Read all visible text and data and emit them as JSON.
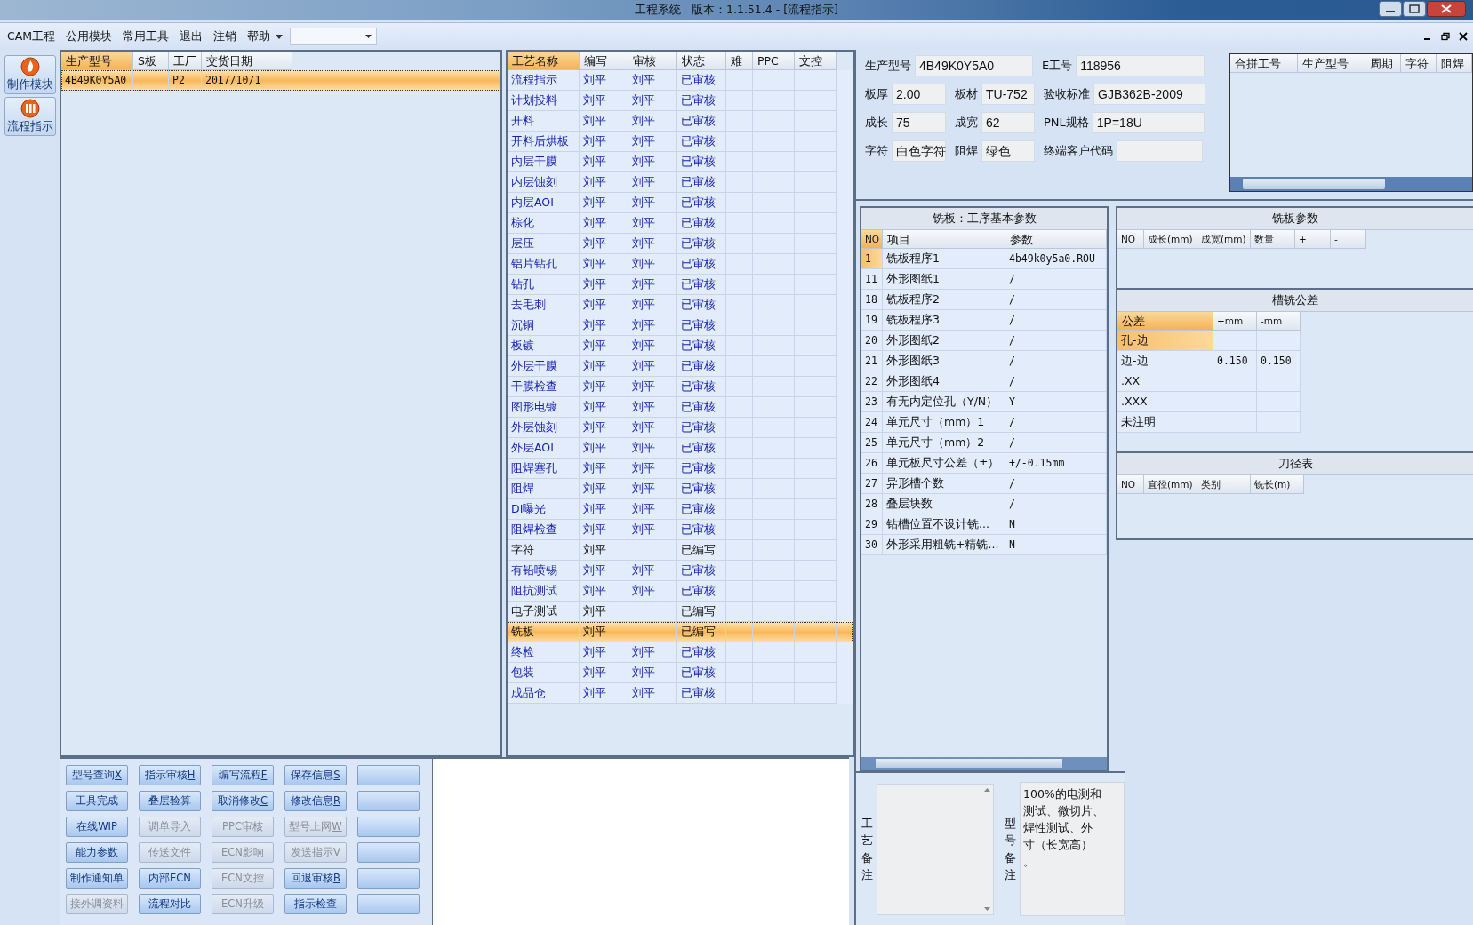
{
  "window": {
    "title": "工程系统   版本：1.1.51.4 - [流程指示]"
  },
  "menu": [
    "CAM工程",
    "公用模块",
    "常用工具",
    "退出",
    "注销",
    "帮助"
  ],
  "side_buttons": [
    {
      "label": "制作模块",
      "kind": "make"
    },
    {
      "label": "流程指示",
      "kind": "flow"
    }
  ],
  "model_table": {
    "columns": [
      {
        "label": "生产型号",
        "selected": true
      },
      {
        "label": "S板",
        "selected": false
      },
      {
        "label": "工厂",
        "selected": false
      },
      {
        "label": "交货日期",
        "selected": false
      }
    ],
    "rows": [
      {
        "cells": [
          "4B49K0Y5A0",
          "",
          "P2",
          "2017/10/1"
        ],
        "selected": true
      }
    ]
  },
  "process_table": {
    "columns": [
      {
        "label": "工艺名称",
        "selected": true
      },
      {
        "label": "编写",
        "selected": false
      },
      {
        "label": "审核",
        "selected": false
      },
      {
        "label": "状态",
        "selected": false
      },
      {
        "label": "难",
        "selected": false
      },
      {
        "label": "PPC",
        "selected": false
      },
      {
        "label": "文控",
        "selected": false
      }
    ],
    "rows": [
      {
        "name": "流程指示",
        "writer": "刘平",
        "reviewer": "刘平",
        "status": "已审核",
        "approved": true,
        "selected": false
      },
      {
        "name": "计划投料",
        "writer": "刘平",
        "reviewer": "刘平",
        "status": "已审核",
        "approved": true,
        "selected": false
      },
      {
        "name": "开料",
        "writer": "刘平",
        "reviewer": "刘平",
        "status": "已审核",
        "approved": true,
        "selected": false
      },
      {
        "name": "开料后烘板",
        "writer": "刘平",
        "reviewer": "刘平",
        "status": "已审核",
        "approved": true,
        "selected": false
      },
      {
        "name": "内层干膜",
        "writer": "刘平",
        "reviewer": "刘平",
        "status": "已审核",
        "approved": true,
        "selected": false
      },
      {
        "name": "内层蚀刻",
        "writer": "刘平",
        "reviewer": "刘平",
        "status": "已审核",
        "approved": true,
        "selected": false
      },
      {
        "name": "内层AOI",
        "writer": "刘平",
        "reviewer": "刘平",
        "status": "已审核",
        "approved": true,
        "selected": false
      },
      {
        "name": "棕化",
        "writer": "刘平",
        "reviewer": "刘平",
        "status": "已审核",
        "approved": true,
        "selected": false
      },
      {
        "name": "层压",
        "writer": "刘平",
        "reviewer": "刘平",
        "status": "已审核",
        "approved": true,
        "selected": false
      },
      {
        "name": "铝片钻孔",
        "writer": "刘平",
        "reviewer": "刘平",
        "status": "已审核",
        "approved": true,
        "selected": false
      },
      {
        "name": "钻孔",
        "writer": "刘平",
        "reviewer": "刘平",
        "status": "已审核",
        "approved": true,
        "selected": false
      },
      {
        "name": "去毛刺",
        "writer": "刘平",
        "reviewer": "刘平",
        "status": "已审核",
        "approved": true,
        "selected": false
      },
      {
        "name": "沉铜",
        "writer": "刘平",
        "reviewer": "刘平",
        "status": "已审核",
        "approved": true,
        "selected": false
      },
      {
        "name": "板镀",
        "writer": "刘平",
        "reviewer": "刘平",
        "status": "已审核",
        "approved": true,
        "selected": false
      },
      {
        "name": "外层干膜",
        "writer": "刘平",
        "reviewer": "刘平",
        "status": "已审核",
        "approved": true,
        "selected": false
      },
      {
        "name": "干膜检查",
        "writer": "刘平",
        "reviewer": "刘平",
        "status": "已审核",
        "approved": true,
        "selected": false
      },
      {
        "name": "图形电镀",
        "writer": "刘平",
        "reviewer": "刘平",
        "status": "已审核",
        "approved": true,
        "selected": false
      },
      {
        "name": "外层蚀刻",
        "writer": "刘平",
        "reviewer": "刘平",
        "status": "已审核",
        "approved": true,
        "selected": false
      },
      {
        "name": "外层AOI",
        "writer": "刘平",
        "reviewer": "刘平",
        "status": "已审核",
        "approved": true,
        "selected": false
      },
      {
        "name": "阻焊塞孔",
        "writer": "刘平",
        "reviewer": "刘平",
        "status": "已审核",
        "approved": true,
        "selected": false
      },
      {
        "name": "阻焊",
        "writer": "刘平",
        "reviewer": "刘平",
        "status": "已审核",
        "approved": true,
        "selected": false
      },
      {
        "name": "DI曝光",
        "writer": "刘平",
        "reviewer": "刘平",
        "status": "已审核",
        "approved": true,
        "selected": false
      },
      {
        "name": "阻焊检查",
        "writer": "刘平",
        "reviewer": "刘平",
        "status": "已审核",
        "approved": true,
        "selected": false
      },
      {
        "name": "字符",
        "writer": "刘平",
        "status": "已编写",
        "approved": false,
        "selected": false
      },
      {
        "name": "有铅喷锡",
        "writer": "刘平",
        "reviewer": "刘平",
        "status": "已审核",
        "approved": true,
        "selected": false
      },
      {
        "name": "阻抗测试",
        "writer": "刘平",
        "reviewer": "刘平",
        "status": "已审核",
        "approved": true,
        "selected": false
      },
      {
        "name": "电子测试",
        "writer": "刘平",
        "status": "已编写",
        "approved": false,
        "selected": false
      },
      {
        "name": "铣板",
        "writer": "刘平",
        "status": "已编写",
        "approved": false,
        "selected": true
      },
      {
        "name": "终检",
        "writer": "刘平",
        "reviewer": "刘平",
        "status": "已审核",
        "approved": true,
        "selected": false
      },
      {
        "name": "包装",
        "writer": "刘平",
        "reviewer": "刘平",
        "status": "已审核",
        "approved": true,
        "selected": false
      },
      {
        "name": "成品仓",
        "writer": "刘平",
        "reviewer": "刘平",
        "status": "已审核",
        "approved": true,
        "selected": false
      }
    ]
  },
  "info": [
    [
      {
        "label": "生产型号",
        "value": "4B49K0Y5A0"
      },
      {
        "label": "E工号",
        "value": "118956"
      }
    ],
    [
      {
        "label": "板厚",
        "value": "2.00"
      },
      {
        "label": "板材",
        "value": "TU-752"
      },
      {
        "label": "验收标准",
        "value": "GJB362B-2009"
      }
    ],
    [
      {
        "label": "成长",
        "value": "75"
      },
      {
        "label": "成宽",
        "value": "62"
      },
      {
        "label": "PNL规格",
        "value": "1P=18U"
      }
    ],
    [
      {
        "label": "字符",
        "value": "白色字符"
      },
      {
        "label": "阻焊",
        "value": "绿色"
      },
      {
        "label": "终端客户代码"
      }
    ]
  ],
  "combined_table": {
    "columns": [
      "合拼工号",
      "生产型号",
      "周期",
      "字符",
      "阻焊"
    ]
  },
  "param_panel": {
    "title": "铣板：工序基本参数",
    "columns": [
      "NO",
      "项目",
      "参数"
    ],
    "rows": [
      {
        "no": "1",
        "item": "铣板程序1",
        "value": "4b49k0y5a0.ROU",
        "selected": true
      },
      {
        "no": "11",
        "item": "外形图纸1",
        "value": "/",
        "selected": false
      },
      {
        "no": "18",
        "item": "铣板程序2",
        "value": "/",
        "selected": false
      },
      {
        "no": "19",
        "item": "铣板程序3",
        "value": "/",
        "selected": false
      },
      {
        "no": "20",
        "item": "外形图纸2",
        "value": "/",
        "selected": false
      },
      {
        "no": "21",
        "item": "外形图纸3",
        "value": "/",
        "selected": false
      },
      {
        "no": "22",
        "item": "外形图纸4",
        "value": "/",
        "selected": false
      },
      {
        "no": "23",
        "item": "有无内定位孔（Y/N）",
        "value": "Y",
        "selected": false
      },
      {
        "no": "24",
        "item": "单元尺寸（mm）1",
        "value": "/",
        "selected": false
      },
      {
        "no": "25",
        "item": "单元尺寸（mm）2",
        "value": "/",
        "selected": false
      },
      {
        "no": "26",
        "item": "单元板尺寸公差（±）",
        "value": "+/-0.15mm",
        "selected": false
      },
      {
        "no": "27",
        "item": "异形槽个数",
        "value": "/",
        "selected": false
      },
      {
        "no": "28",
        "item": "叠层块数",
        "value": "/",
        "selected": false
      },
      {
        "no": "29",
        "item": "钻槽位置不设计铣...",
        "value": "N",
        "selected": false
      },
      {
        "no": "30",
        "item": "外形采用粗铣+精铣...",
        "value": "N",
        "selected": false
      }
    ]
  },
  "mill_panel": {
    "title": "铣板参数",
    "columns": [
      "NO",
      "成长(mm)",
      "成宽(mm)",
      "数量",
      "+",
      "-"
    ]
  },
  "tolerance_panel": {
    "title": "槽铣公差",
    "columns": [
      "公差",
      "+mm",
      "-mm"
    ],
    "rows": [
      {
        "name": "孔-边",
        "selected": true
      },
      {
        "name": "边-边",
        "plus": "0.150",
        "minus": "0.150",
        "selected": false
      },
      {
        "name": ".XX",
        "selected": false
      },
      {
        "name": ".XXX",
        "selected": false
      },
      {
        "name": "未注明",
        "selected": false
      }
    ]
  },
  "tool_panel": {
    "title": "刀径表",
    "columns": [
      "NO",
      "直径(mm)",
      "类别",
      "铣长(m)"
    ]
  },
  "buttons": [
    [
      {
        "label": "型号查询",
        "key": "X",
        "disabled": false
      },
      {
        "label": "指示审核",
        "key": "H",
        "disabled": false
      },
      {
        "label": "编写流程",
        "key": "F",
        "disabled": false
      },
      {
        "label": "保存信息",
        "key": "S",
        "disabled": false
      }
    ],
    [
      {
        "label": "工具完成",
        "disabled": false
      },
      {
        "label": "叠层验算",
        "disabled": false
      },
      {
        "label": "取消修改",
        "key": "C",
        "disabled": false
      },
      {
        "label": "修改信息",
        "key": "R",
        "disabled": false
      }
    ],
    [
      {
        "label": "在线WIP",
        "disabled": false
      },
      {
        "label": "调单导入",
        "disabled": true
      },
      {
        "label": "PPC审核",
        "disabled": true
      },
      {
        "label": "型号上网",
        "key": "W",
        "disabled": true
      }
    ],
    [
      {
        "label": "能力参数",
        "disabled": false
      },
      {
        "label": "传送文件",
        "disabled": true
      },
      {
        "label": "ECN影响",
        "disabled": true
      },
      {
        "label": "发送指示",
        "key": "V",
        "disabled": true
      }
    ],
    [
      {
        "label": "制作通知单",
        "disabled": false
      },
      {
        "label": "内部ECN",
        "disabled": false
      },
      {
        "label": "ECN文控",
        "disabled": true
      },
      {
        "label": "回退审核",
        "key": "B",
        "disabled": false
      }
    ],
    [
      {
        "label": "接外调资料",
        "disabled": true
      },
      {
        "label": "流程对比",
        "disabled": false
      },
      {
        "label": "ECN升级",
        "disabled": true
      },
      {
        "label": "指示检查",
        "disabled": false
      }
    ]
  ],
  "process_remark": {
    "label": "工艺备注"
  },
  "model_remark": {
    "label": "型号备注",
    "lines": [
      "100%的电测和",
      "测试、微切片、",
      "焊性测试、外",
      "寸（长宽高）",
      "。"
    ]
  }
}
